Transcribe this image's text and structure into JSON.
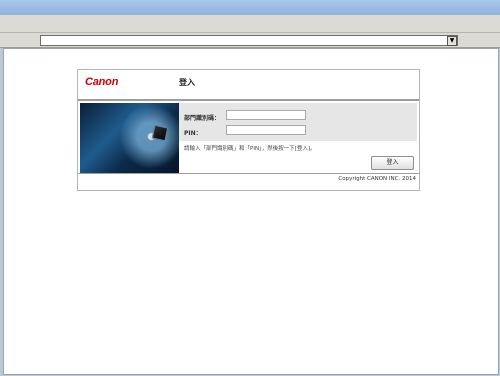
{
  "browser": {
    "address_placeholder": "",
    "dropdown_glyph": "▼"
  },
  "page": {
    "brand": "Canon",
    "title": "登入",
    "dept_id_label": "部門識別碼：",
    "pin_label": "PIN：",
    "instruction": "請輸入「部門識別碼」和「PIN」，然後按一下[登入]。",
    "login_button": "登入",
    "copyright": "Copyright CANON INC. 2014"
  },
  "colors": {
    "brand": "#d20000",
    "form_background": "#e6e6e6"
  }
}
